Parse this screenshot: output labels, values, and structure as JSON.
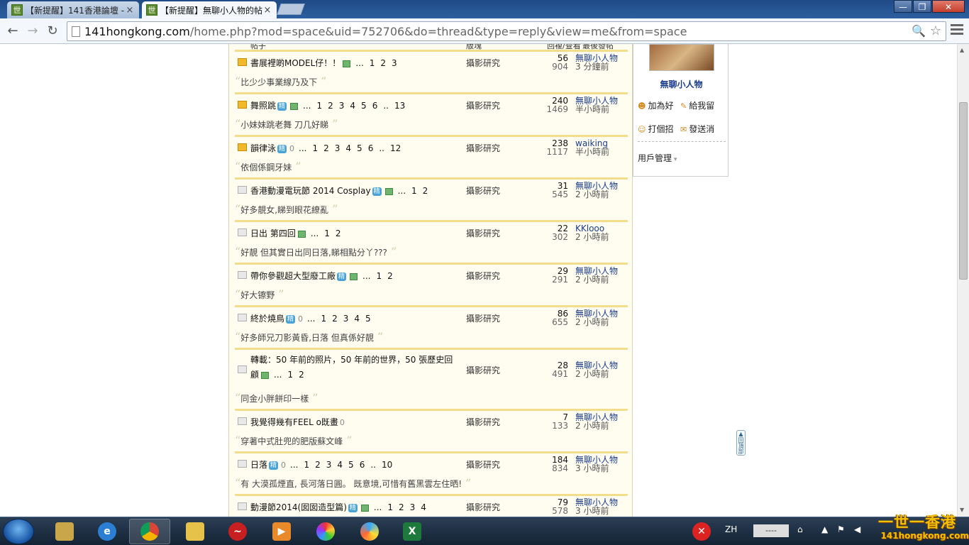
{
  "browser": {
    "tabs": [
      {
        "favicon": "世",
        "title": "【新提醒】141香港論壇 -",
        "close": "×"
      },
      {
        "favicon": "世",
        "title": "【新提醒】無聊小人物的帖",
        "close": "×"
      }
    ],
    "window_controls": {
      "minimize": "—",
      "maximize": "❐",
      "close": "✕"
    },
    "url_host": "141hongkong.com",
    "url_rest": "/home.php?mod=space&uid=752706&do=thread&type=reply&view=me&from=space",
    "back": "←",
    "forward": "→",
    "reload": "↻",
    "zoom": "🔍",
    "star": "☆"
  },
  "table_header": {
    "subject": "帖子",
    "forum": "版塊",
    "stats": "回複/查看",
    "last": "最後發帖"
  },
  "threads": [
    {
      "icon": "hot",
      "subject": "書展裡啲MODEL仔！！",
      "tags": [
        "img"
      ],
      "pages": [
        "...",
        "1",
        "2",
        "3"
      ],
      "forum": "攝影研究",
      "replies": "56",
      "views": "904",
      "last_user": "無聊小人物",
      "last_time": "3 分鐘前",
      "quote": "比少少事業線乃及下"
    },
    {
      "icon": "hot",
      "subject": "舞照跳",
      "tags": [
        "精",
        "img"
      ],
      "pages": [
        "...",
        "1",
        "2",
        "3",
        "4",
        "5",
        "6",
        "..",
        "13"
      ],
      "forum": "攝影研究",
      "replies": "240",
      "views": "1469",
      "last_user": "無聊小人物",
      "last_time": "半小時前",
      "quote": "小妹妹跳老舞 刀几好睇"
    },
    {
      "icon": "hot",
      "subject": "韻律泳",
      "tags": [
        "精",
        "att"
      ],
      "pages": [
        "...",
        "1",
        "2",
        "3",
        "4",
        "5",
        "6",
        "..",
        "12"
      ],
      "forum": "攝影研究",
      "replies": "238",
      "views": "1117",
      "last_user": "waiking",
      "last_time": "半小時前",
      "quote": "依個係鋼牙妹"
    },
    {
      "icon": "norm",
      "subject": "香港動漫電玩節 2014 Cosplay",
      "tags": [
        "精",
        "img"
      ],
      "pages": [
        "...",
        "1",
        "2"
      ],
      "forum": "攝影研究",
      "replies": "31",
      "views": "545",
      "last_user": "無聊小人物",
      "last_time": "2 小時前",
      "quote": "好多靚女,睇到眼花繚亂"
    },
    {
      "icon": "norm",
      "subject": "日出 第四回",
      "tags": [
        "img"
      ],
      "pages": [
        "...",
        "1",
        "2"
      ],
      "forum": "攝影研究",
      "replies": "22",
      "views": "302",
      "last_user": "KKlooo",
      "last_time": "2 小時前",
      "quote": "好靚 但其實日出同日落,睇相點分丫???"
    },
    {
      "icon": "norm",
      "subject": "帶你參觀超大型廢工廠",
      "tags": [
        "精",
        "img"
      ],
      "pages": [
        "...",
        "1",
        "2"
      ],
      "forum": "攝影研究",
      "replies": "29",
      "views": "291",
      "last_user": "無聊小人物",
      "last_time": "2 小時前",
      "quote": "好大镲野"
    },
    {
      "icon": "norm",
      "subject": "終於燒鳥",
      "tags": [
        "精",
        "att"
      ],
      "pages": [
        "...",
        "1",
        "2",
        "3",
        "4",
        "5"
      ],
      "forum": "攝影研究",
      "replies": "86",
      "views": "655",
      "last_user": "無聊小人物",
      "last_time": "2 小時前",
      "quote": "好多師兄刀影黃昏,日落 但真係好靚"
    },
    {
      "icon": "norm",
      "subject": "轉載：50 年前的照片，50 年前的世界，50 張歷史回顧",
      "tags": [
        "img"
      ],
      "pages": [
        "...",
        "1",
        "2"
      ],
      "forum": "攝影研究",
      "replies": "28",
      "views": "491",
      "last_user": "無聊小人物",
      "last_time": "2 小時前",
      "quote": "同金小胖餅印一樣",
      "wrap": true
    },
    {
      "icon": "norm",
      "subject": "我覺得幾有FEEL o既畫",
      "tags": [
        "att"
      ],
      "pages": [],
      "forum": "攝影研究",
      "replies": "7",
      "views": "133",
      "last_user": "無聊小人物",
      "last_time": "2 小時前",
      "quote": "穿著中式肚兜的肥版蘇文峰"
    },
    {
      "icon": "norm",
      "subject": "日落",
      "tags": [
        "精",
        "att"
      ],
      "pages": [
        "...",
        "1",
        "2",
        "3",
        "4",
        "5",
        "6",
        "..",
        "10"
      ],
      "forum": "攝影研究",
      "replies": "184",
      "views": "834",
      "last_user": "無聊小人物",
      "last_time": "3 小時前",
      "quote": "有 大漠孤煙直, 長河落日圓。 既意境,可惜有舊黑雲左住晒!"
    },
    {
      "icon": "norm",
      "subject": "動漫節2014(囡囡造型篇)",
      "tags": [
        "精",
        "img"
      ],
      "pages": [
        "...",
        "1",
        "2",
        "3",
        "4"
      ],
      "forum": "攝影研究",
      "replies": "79",
      "views": "578",
      "last_user": "無聊小人物",
      "last_time": "3 小時前",
      "quote": ""
    }
  ],
  "sidebar": {
    "username": "無聊小人物",
    "actions": {
      "add_friend": "加為好",
      "message": "給我留",
      "greet": "打個招",
      "send_msg": "發送消"
    },
    "user_manage": "用戶管理"
  },
  "scroll_top": "回頂部",
  "taskbar": {
    "lang": "ZH",
    "brand_big": "一世一香港",
    "brand_small": "141hongkong.com",
    "clock": "18:"
  },
  "colors": {
    "accent_row": "#f3dc8a",
    "link": "#1a3c8c",
    "badge": "#4aa3d8"
  }
}
